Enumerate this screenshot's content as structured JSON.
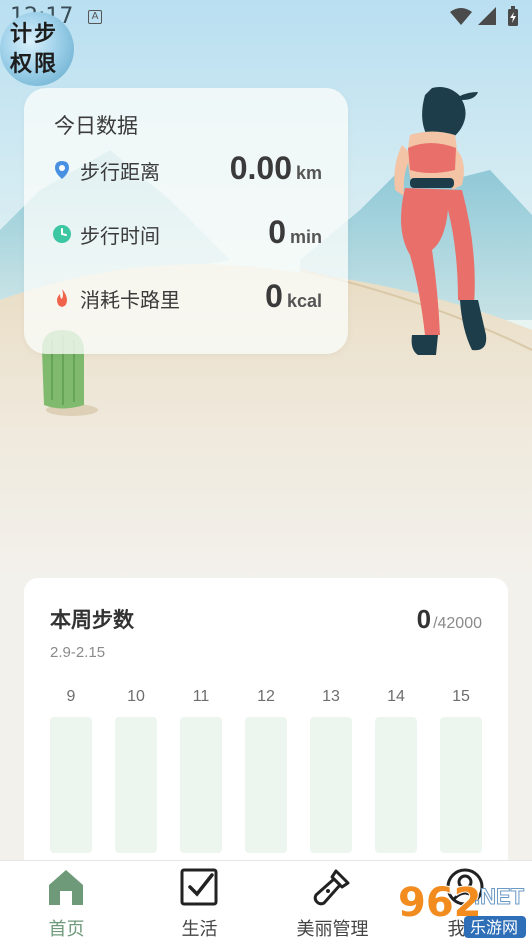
{
  "status_bar": {
    "time": "12:17",
    "notification_icon": "a-icon",
    "icons": [
      "wifi-icon",
      "signal-icon",
      "battery-icon"
    ]
  },
  "permission_badge": {
    "text": "计步权限"
  },
  "today": {
    "title": "今日数据",
    "metrics": [
      {
        "icon": "location-pin-icon",
        "icon_color": "#4a90e2",
        "label": "步行距离",
        "value": "0.00",
        "unit": "km"
      },
      {
        "icon": "clock-icon",
        "icon_color": "#3cc6a1",
        "label": "步行时间",
        "value": "0",
        "unit": "min"
      },
      {
        "icon": "flame-icon",
        "icon_color": "#f0644b",
        "label": "消耗卡路里",
        "value": "0",
        "unit": "kcal"
      }
    ]
  },
  "weekly": {
    "title": "本周步数",
    "date_range": "2.9-2.15",
    "current_steps": "0",
    "goal": "/42000",
    "days": [
      "9",
      "10",
      "11",
      "12",
      "13",
      "14",
      "15"
    ],
    "day_progress": [
      0,
      0,
      0,
      0,
      0,
      0,
      0
    ],
    "bar_color": "#edf5ef",
    "accent": "#8fb59a"
  },
  "nav": {
    "active_color": "#6e9a7a",
    "items": [
      {
        "label": "首页",
        "icon": "home-icon",
        "active": true
      },
      {
        "label": "生活",
        "icon": "checkbox-icon",
        "active": false
      },
      {
        "label": "美丽管理",
        "icon": "flashlight-icon",
        "active": false
      },
      {
        "label": "我的",
        "icon": "profile-icon",
        "active": false
      }
    ]
  },
  "watermark": {
    "brand": "962",
    "suffix": ".NET",
    "sub": "乐游网"
  }
}
